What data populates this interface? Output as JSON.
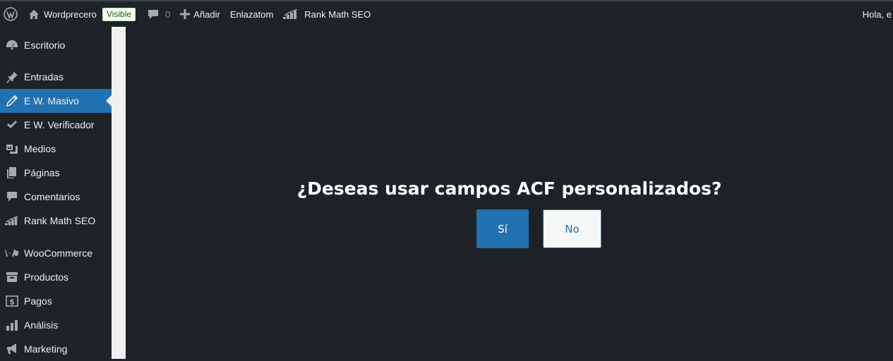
{
  "adminbar": {
    "site_name": "Wordprecero",
    "visibility_badge": "Visible",
    "comments_count": "0",
    "add_new": "Añadir",
    "link_item": "Enlazatom",
    "rankmath": "Rank Math SEO",
    "greeting": "Hola, e"
  },
  "sidebar": {
    "items": [
      {
        "label": "Escritorio",
        "icon": "dashboard-icon"
      },
      {
        "label": "Entradas",
        "icon": "pushpin-icon"
      },
      {
        "label": "E W. Masivo",
        "icon": "pencil-icon",
        "active": true
      },
      {
        "label": "E W. Verificador",
        "icon": "checkmark-icon"
      },
      {
        "label": "Medios",
        "icon": "media-icon"
      },
      {
        "label": "Páginas",
        "icon": "pages-icon"
      },
      {
        "label": "Comentarios",
        "icon": "comment-icon"
      },
      {
        "label": "Rank Math SEO",
        "icon": "rankmath-icon"
      },
      {
        "label": "WooCommerce",
        "icon": "woocommerce-icon"
      },
      {
        "label": "Productos",
        "icon": "archive-icon"
      },
      {
        "label": "Pagos",
        "icon": "dollar-icon"
      },
      {
        "label": "Análisis",
        "icon": "bar-chart-icon"
      },
      {
        "label": "Marketing",
        "icon": "megaphone-icon"
      }
    ]
  },
  "dialog": {
    "question": "¿Deseas usar campos ACF personalizados?",
    "yes_label": "Sí",
    "no_label": "No"
  },
  "colors": {
    "accent": "#2271b1",
    "sidebar_bg": "#1d2327",
    "main_bg": "#1e2227"
  }
}
